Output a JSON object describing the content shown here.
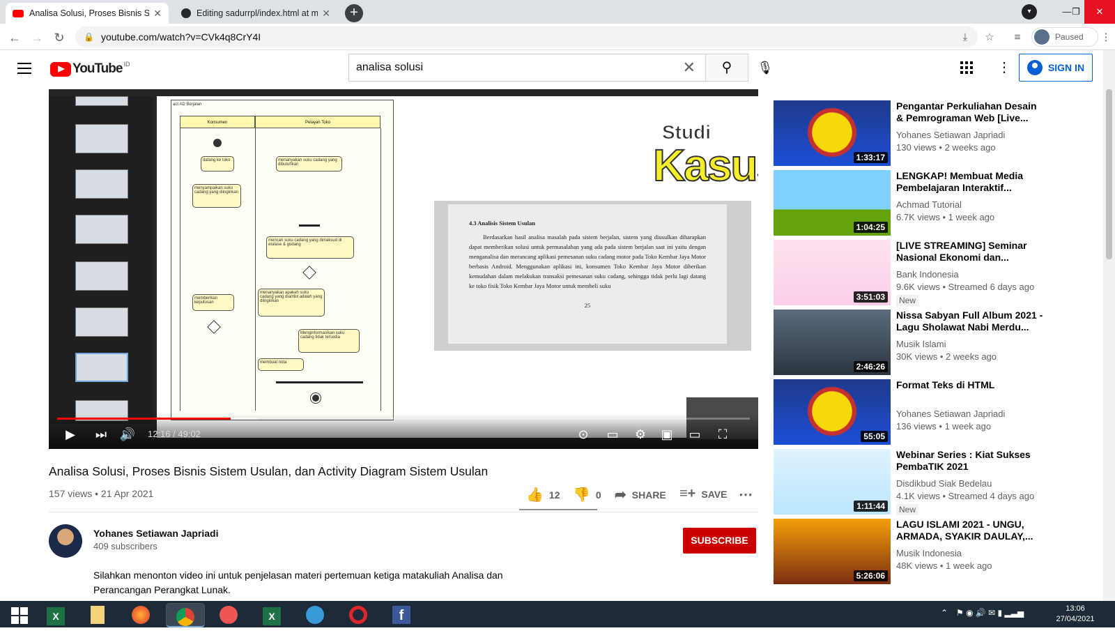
{
  "browser": {
    "tabs": [
      {
        "title": "Analisa Solusi, Proses Bisnis Siste",
        "favicon": "youtube-icon",
        "active": true
      },
      {
        "title": "Editing sadurrpl/index.html at m",
        "favicon": "github-icon",
        "active": false
      }
    ],
    "url": "youtube.com/watch?v=CVk4q8CrY4I",
    "profile_status": "Paused"
  },
  "header": {
    "logo_text": "YouTube",
    "country": "ID",
    "search_value": "analisa solusi",
    "sign_in": "SIGN IN"
  },
  "player": {
    "time": "12:16 / 49:02",
    "progress": 0.25,
    "buffered": 0.29,
    "slide": {
      "studi": "Studi",
      "kasus": "Kasus",
      "diagram_title": "act AD Berjalan",
      "lanes": [
        "Konsumen",
        "Pelayan Toko"
      ],
      "activities": [
        "datang ke toko",
        "menanyakan suku cadang yang dibutuhkan",
        "menyampaikan suku cadang yang diinginkan",
        "mencari suku cadang yang dimaksud di etalase & gudang",
        "menanyakan apakah suku cadang yang diambil adalah yang diinginkan",
        "memberikan keputusan",
        "Menginformasikan suku cadang tidak tersedia",
        "membuat nota"
      ],
      "book_heading": "4.3   Analisis Sistem Usulan",
      "book_text": "Berdasarkan hasil analisa masalah pada sistem berjalan, sistem yang diusulkan diharapkan dapat memberikan solusi untuk permasalahan yang ada pada sistem berjalan saat ini yaitu dengan menganalisa dan merancang aplikasi pemesanan suku cadang motor pada Toko Kembar Jaya Motor berbasis Android. Menggunakan aplikasi ini, konsumen Toko Kembar Jaya Motor diberikan kemudahan dalam melakukan transaksi pemesanan suku cadang, sehingga tidak perlu lagi datang ke toko fisik Toko Kembar Jaya Motor untuk membeli suku",
      "page_number": "25"
    }
  },
  "video": {
    "title": "Analisa Solusi, Proses Bisnis Sistem Usulan, dan Activity Diagram Sistem Usulan",
    "meta": "157 views • 21 Apr 2021",
    "likes": "12",
    "dislikes": "0",
    "share": "SHARE",
    "save": "SAVE"
  },
  "channel": {
    "name": "Yohanes Setiawan Japriadi",
    "subs": "409 subscribers",
    "subscribe": "SUBSCRIBE",
    "description": "Silahkan menonton video ini untuk penjelasan materi pertemuan ketiga matakuliah Analisa dan Perancangan Perangkat Lunak."
  },
  "related": [
    {
      "title": "Pengantar Perkuliahan Desain & Pemrograman Web [Live...",
      "channel": "Yohanes Setiawan Japriadi",
      "views": "130 views • 2 weeks ago",
      "duration": "1:33:17",
      "badge": "",
      "thumb": "atma"
    },
    {
      "title": "LENGKAP! Membuat Media Pembelajaran Interaktif...",
      "channel": "Achmad Tutorial",
      "views": "6.7K views • 1 week ago",
      "duration": "1:04:25",
      "badge": "",
      "thumb": "media"
    },
    {
      "title": "[LIVE STREAMING] Seminar Nasional Ekonomi dan...",
      "channel": "Bank Indonesia",
      "views": "9.6K views • Streamed 6 days ago",
      "duration": "3:51:03",
      "badge": "New",
      "thumb": "seminar"
    },
    {
      "title": "Nissa Sabyan Full Album 2021 - Lagu Sholawat Nabi Merdu...",
      "channel": "Musik Islami",
      "views": "30K views • 2 weeks ago",
      "duration": "2:46:26",
      "badge": "",
      "thumb": "nissa"
    },
    {
      "title": "Format Teks di HTML",
      "channel": "Yohanes Setiawan Japriadi",
      "views": "136 views • 1 week ago",
      "duration": "55:05",
      "badge": "",
      "thumb": "atma"
    },
    {
      "title": "Webinar Series : Kiat Sukses PembaTIK 2021",
      "channel": "Disdikbud Siak Bedelau",
      "views": "4.1K views • Streamed 4 days ago",
      "duration": "1:11:44",
      "badge": "New",
      "thumb": "webinar"
    },
    {
      "title": "LAGU ISLAMI 2021 - UNGU, ARMADA, SYAKIR DAULAY,...",
      "channel": "Musik Indonesia",
      "views": "48K views • 1 week ago",
      "duration": "5:26:06",
      "badge": "",
      "thumb": "lagu"
    }
  ],
  "taskbar": {
    "time": "13:06",
    "date": "27/04/2021",
    "apps": [
      "windows-start-icon",
      "excel-icon",
      "file-explorer-icon",
      "firefox-icon",
      "chrome-icon",
      "app-icon",
      "excel-icon",
      "app-icon",
      "opera-icon",
      "facebook-icon"
    ]
  }
}
